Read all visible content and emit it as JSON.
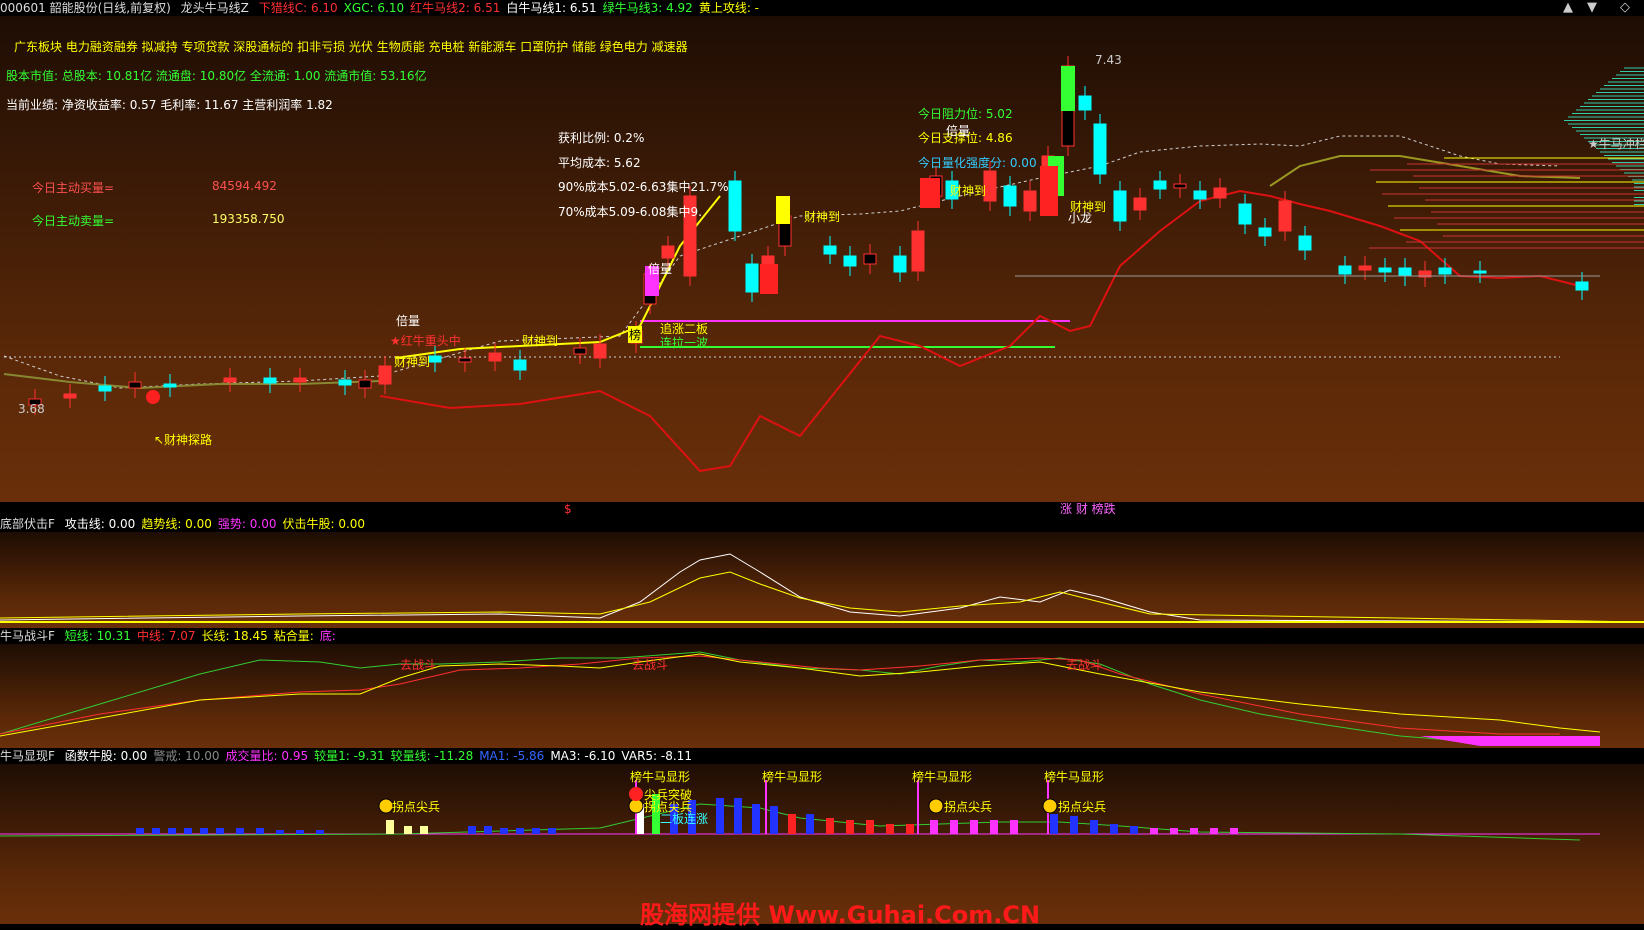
{
  "title_bar": {
    "stock": "000601 韶能股份(日线,前复权)",
    "indicator": "龙头牛马线Z",
    "items": [
      {
        "label": "下猎线C: 6.10",
        "color": "#ff3030"
      },
      {
        "label": "XGC: 6.10",
        "color": "#33ff33"
      },
      {
        "label": "红牛马线2: 6.51",
        "color": "#ff3030"
      },
      {
        "label": "白牛马线1: 6.51",
        "color": "#ffffff"
      },
      {
        "label": "绿牛马线3: 4.92",
        "color": "#33ff33"
      },
      {
        "label": "黄上攻线: -",
        "color": "#ffff00"
      }
    ],
    "controls": {
      "up": "▲",
      "down": "▼",
      "diamond": "◇"
    }
  },
  "info": {
    "sectors": "广东板块  电力融资融券  拟减持  专项贷款  深股通标的  扣非亏损  光伏  生物质能  充电桩  新能源车  口罩防护  储能  绿色电力  减速器",
    "capital": "股本市值: 总股本: 10.81亿  流通盘: 10.80亿  全流通: 1.00  流通市值: 53.16亿",
    "performance": "当前业绩:  净资收益率: 0.57  毛利率: 11.67  主营利润率 1.82",
    "buy_label": "今日主动买量=",
    "buy_value": "84594.492",
    "sell_label": "今日主动卖量=",
    "sell_value": "193358.750",
    "profit_ratio": "获利比例: 0.2%",
    "avg_cost": "平均成本: 5.62",
    "cost90": "90%成本5.02-6.63集中21.7%",
    "cost70": "70%成本5.09-6.08集中9.",
    "resistance": "今日阻力位:  5.02",
    "support": "今日支撑位:  4.86",
    "strength": "今日量化强度分:  0.00"
  },
  "chart_labels": {
    "high_price": "7.43",
    "low_price": "3.68",
    "cai_shen_tan_lu": "↖财神探路",
    "bei_liang": "倍量",
    "red_star": "★红牛重头中",
    "cai_shen_dao": "财神到",
    "zhui_zhang": "追涨二板",
    "lian_la": "连拉一波",
    "xiao_long": "小龙",
    "niu_ma_chong_lan": "★牛马冲栏",
    "bang": "榜",
    "sep_dollar": "$",
    "sep_tags": "涨 财 榜跌"
  },
  "panel1": {
    "name": "底部伏击F",
    "items": [
      {
        "label": "攻击线: 0.00",
        "color": "#ffffff"
      },
      {
        "label": "趋势线: 0.00",
        "color": "#ffff00"
      },
      {
        "label": "强势: 0.00",
        "color": "#ff33ff"
      },
      {
        "label": "伏击牛股: 0.00",
        "color": "#ffff00"
      }
    ]
  },
  "panel2": {
    "name": "牛马战斗F",
    "items": [
      {
        "label": "短线: 10.31",
        "color": "#33ff33"
      },
      {
        "label": "中线: 7.07",
        "color": "#ff3030"
      },
      {
        "label": "长线: 18.45",
        "color": "#ffff00"
      },
      {
        "label": "粘合量:",
        "color": "#ffff00"
      },
      {
        "label": "底:",
        "color": "#ff33ff"
      }
    ],
    "tag": "去战斗"
  },
  "panel3": {
    "name": "牛马显现F",
    "items": [
      {
        "label": "函数牛股: 0.00",
        "color": "#ffffff"
      },
      {
        "label": "警戒: 10.00",
        "color": "#888888"
      },
      {
        "label": "成交量比: 0.95",
        "color": "#ff33ff"
      },
      {
        "label": "较量1: -9.31",
        "color": "#33ff33"
      },
      {
        "label": "较量线: -11.28",
        "color": "#33ff33"
      },
      {
        "label": "MA1: -5.86",
        "color": "#3366ff"
      },
      {
        "label": "MA3: -6.10",
        "color": "#ffffff"
      },
      {
        "label": "VAR5: -8.11",
        "color": "#ffffff"
      }
    ],
    "niu_ma": "榜牛马显形",
    "guai_dian": "拐点尖兵",
    "jian_bing": "尖兵突破",
    "er_ban": "二板连涨"
  },
  "watermark": "股海网提供 Www.Guhai.Com.CN",
  "colors": {
    "up": "#ff3030",
    "down": "#00ffff",
    "accent": "#ffff00"
  }
}
